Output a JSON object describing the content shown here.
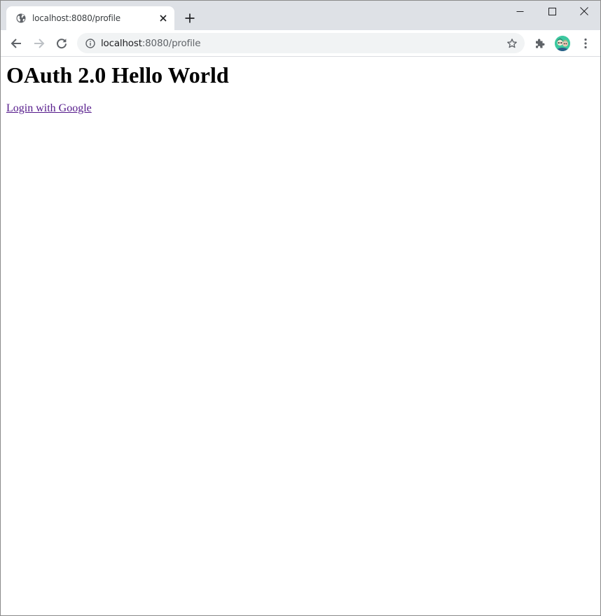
{
  "browser": {
    "tab": {
      "title": "localhost:8080/profile",
      "favicon": "globe-icon"
    },
    "address_bar": {
      "host": "localhost",
      "path": ":8080/profile"
    },
    "colors": {
      "tabstrip_bg": "#dee1e6",
      "omnibox_bg": "#f1f3f4",
      "avatar_bg": "#3cc8a0"
    }
  },
  "page": {
    "heading": "OAuth 2.0 Hello World",
    "login_link": "Login with Google",
    "colors": {
      "link_visited": "#551a8b"
    }
  }
}
